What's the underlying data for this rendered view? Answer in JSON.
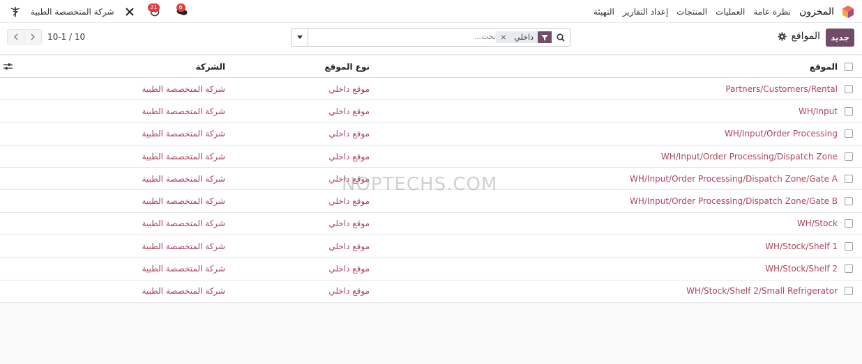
{
  "navbar": {
    "app_name": "المخزون",
    "menu": [
      "نظرة عامة",
      "العمليات",
      "المنتجات",
      "إعداد التقارير",
      "التهيئة"
    ],
    "company": "شركة المتخصصة الطبية",
    "activity_count": "21",
    "chat_count": "6"
  },
  "control": {
    "new_button": "جديد",
    "title": "المواقع",
    "search": {
      "facet_value": "داخلي",
      "placeholder": "بحث..."
    },
    "pager": "10-1 / 10"
  },
  "table": {
    "headers": {
      "location": "الموقع",
      "type": "نوع الموقع",
      "company": "الشركة"
    },
    "rows": [
      {
        "location": "Partners/Customers/Rental",
        "type": "موقع داخلي",
        "company": "شركة المتخصصة الطبية"
      },
      {
        "location": "WH/Input",
        "type": "موقع داخلي",
        "company": "شركة المتخصصة الطبية"
      },
      {
        "location": "WH/Input/Order Processing",
        "type": "موقع داخلي",
        "company": "شركة المتخصصة الطبية"
      },
      {
        "location": "WH/Input/Order Processing/Dispatch Zone",
        "type": "موقع داخلي",
        "company": "شركة المتخصصة الطبية"
      },
      {
        "location": "WH/Input/Order Processing/Dispatch Zone/Gate A",
        "type": "موقع داخلي",
        "company": "شركة المتخصصة الطبية"
      },
      {
        "location": "WH/Input/Order Processing/Dispatch Zone/Gate B",
        "type": "موقع داخلي",
        "company": "شركة المتخصصة الطبية"
      },
      {
        "location": "WH/Stock",
        "type": "موقع داخلي",
        "company": "شركة المتخصصة الطبية"
      },
      {
        "location": "WH/Stock/Shelf 1",
        "type": "موقع داخلي",
        "company": "شركة المتخصصة الطبية"
      },
      {
        "location": "WH/Stock/Shelf 2",
        "type": "موقع داخلي",
        "company": "شركة المتخصصة الطبية"
      },
      {
        "location": "WH/Stock/Shelf 2/Small Refrigerator",
        "type": "موقع داخلي",
        "company": "شركة المتخصصة الطبية"
      }
    ]
  },
  "watermark": "NOPTECHS.COM",
  "colors": {
    "brand": "#714b67",
    "link": "#b0445c",
    "badge": "#e03f3f"
  }
}
